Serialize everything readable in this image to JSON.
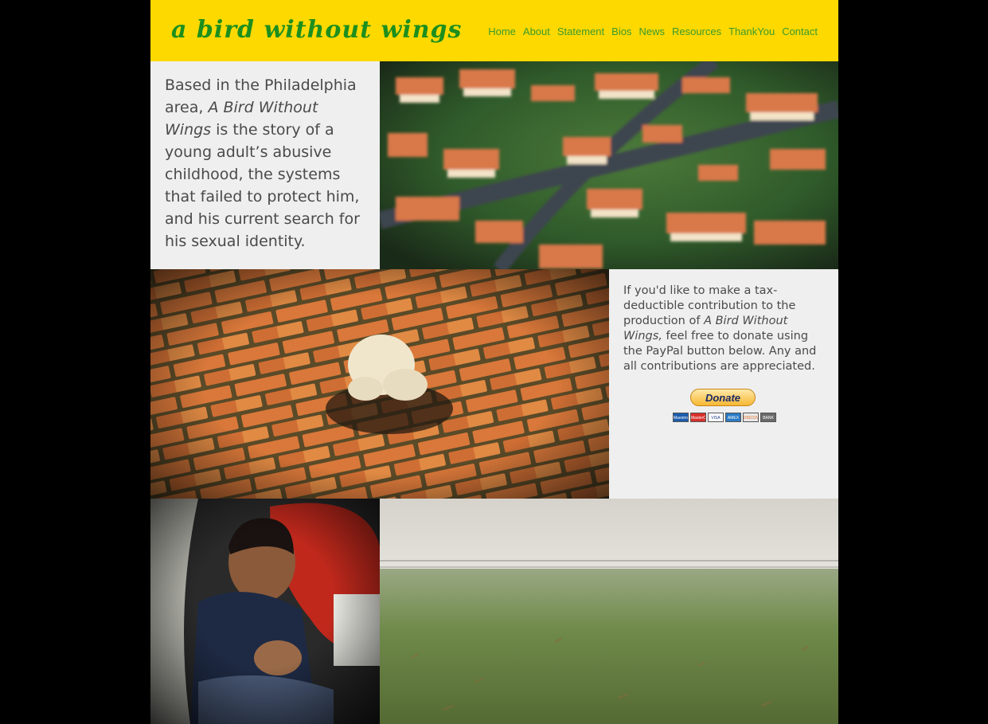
{
  "header": {
    "logo": "a bird without wings",
    "nav": [
      "Home",
      "About",
      "Statement",
      "Bios",
      "News",
      "Resources",
      "ThankYou",
      "Contact"
    ]
  },
  "intro": {
    "before": "Based in the Philadelphia area, ",
    "title": "A Bird Without Wings",
    "after": " is the story of a young adult’s abusive childhood, the systems that failed to protect him, and his current search for his sexual identity."
  },
  "donate": {
    "before": "If you'd like to make a tax-deductible contribution to the production of ",
    "title": "A Bird Without Wings,",
    "after": " feel free to donate using the PayPal button below. Any and all contributions are appreciated.",
    "button_label": "Donate",
    "cards": [
      "Maestro",
      "MasterCard",
      "VISA",
      "AMEX",
      "DISCOVER",
      "BANK"
    ]
  },
  "colors": {
    "header_bg": "#fdd900",
    "logo": "#1d8f1d",
    "nav_link": "#3a9a2e",
    "panel_bg": "#efefef",
    "body_bg": "#000000"
  }
}
